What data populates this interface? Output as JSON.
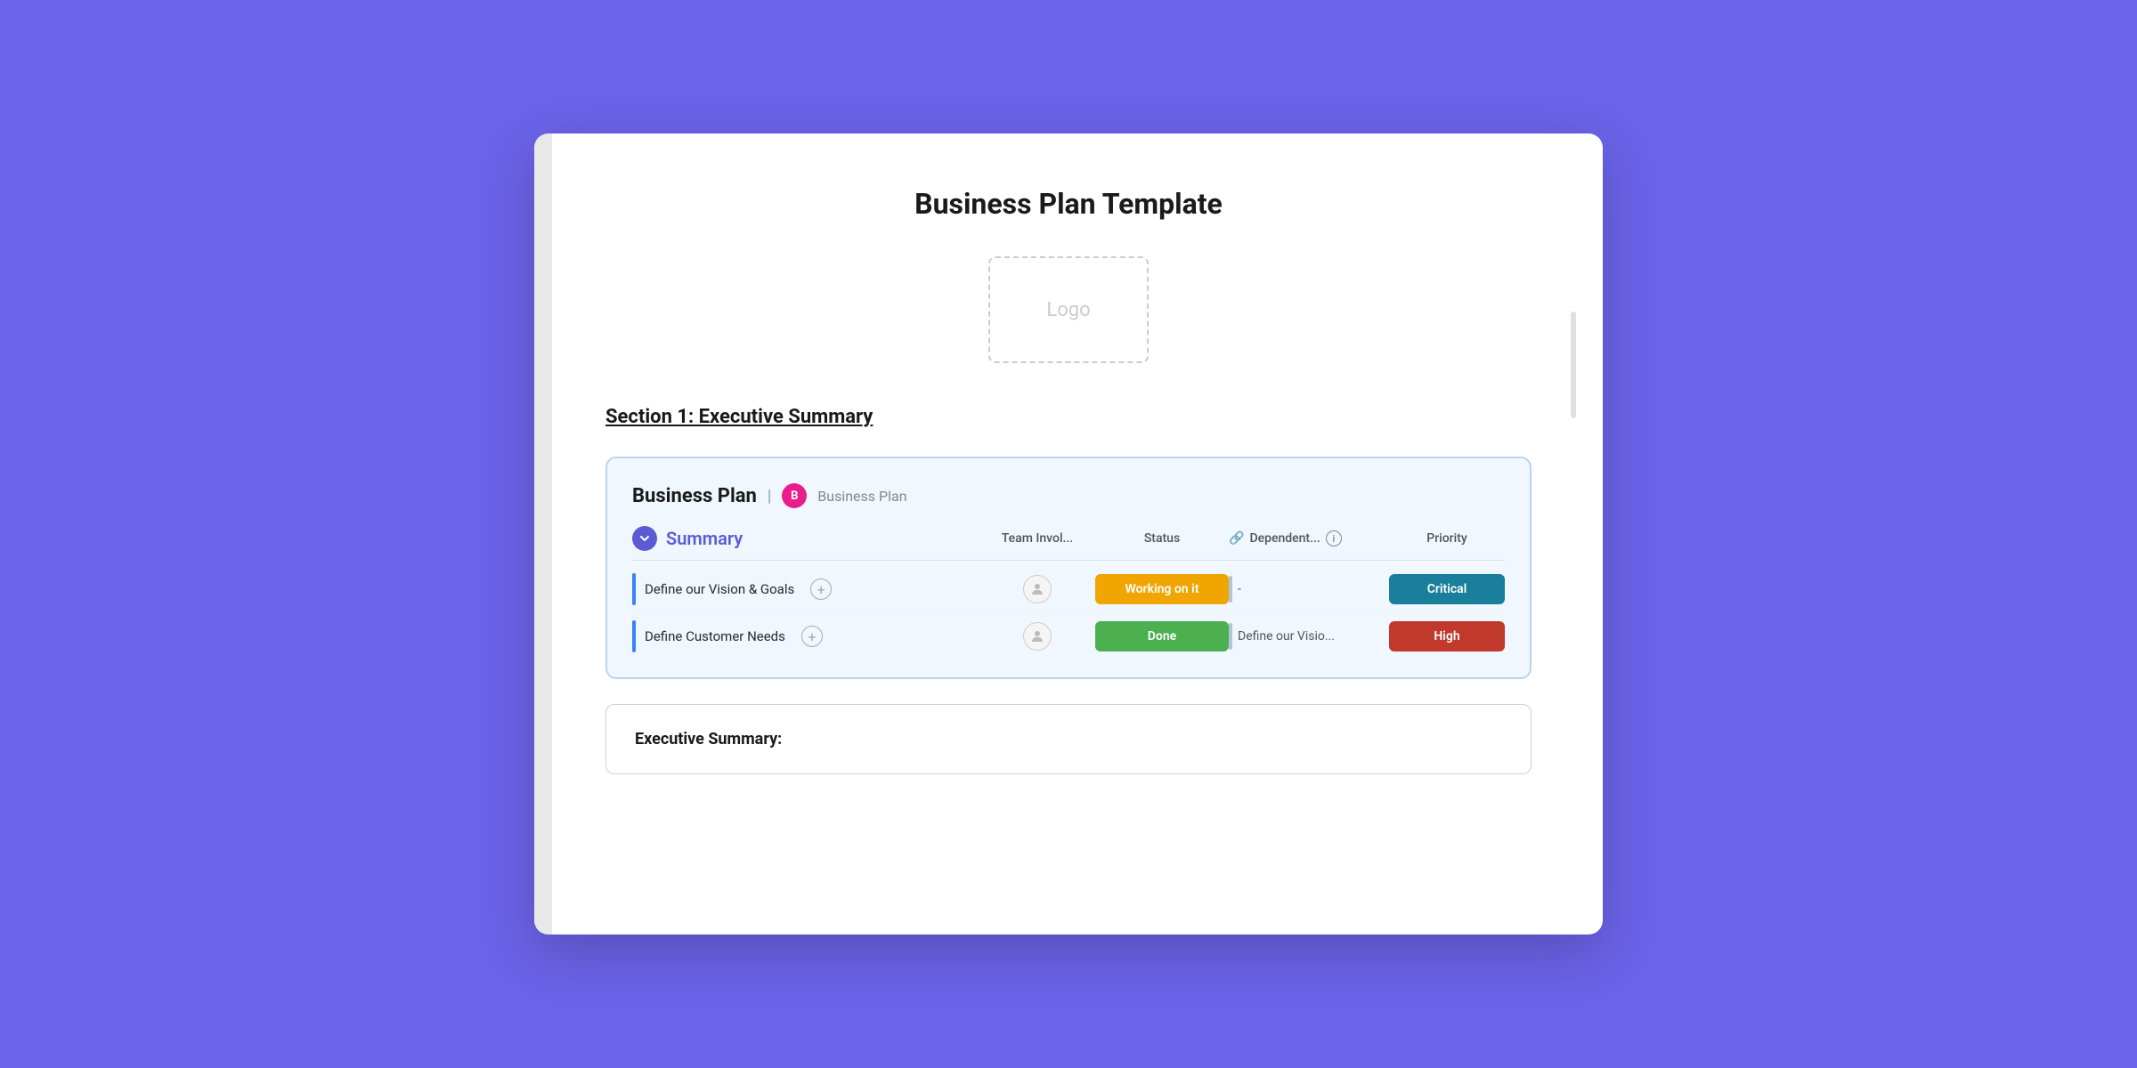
{
  "page": {
    "background_color": "#6B63E8",
    "title": "Business Plan Template",
    "logo_placeholder": "Logo",
    "section_heading": "Section 1: Executive Summary"
  },
  "board": {
    "title": "Business Plan",
    "separator": "|",
    "badge_letter": "B",
    "badge_bg": "#e91e8c",
    "subtitle": "Business Plan",
    "group_name": "Summary",
    "columns": {
      "team": "Team Invol...",
      "status": "Status",
      "dependent": "Dependent...",
      "priority": "Priority"
    },
    "tasks": [
      {
        "name": "Define our Vision & Goals",
        "bar_color": "#3b82f6",
        "status_label": "Working on it",
        "status_class": "status-working",
        "dependent_text": "-",
        "priority_label": "Critical",
        "priority_class": "priority-critical"
      },
      {
        "name": "Define Customer Needs",
        "bar_color": "#3b82f6",
        "status_label": "Done",
        "status_class": "status-done",
        "dependent_text": "Define our Visio...",
        "priority_label": "High",
        "priority_class": "priority-high"
      }
    ]
  },
  "executive_summary": {
    "title": "Executive Summary:"
  },
  "icons": {
    "arrow_down": "▼",
    "plus": "+",
    "user": "👤",
    "link": "🔗",
    "info": "i"
  }
}
